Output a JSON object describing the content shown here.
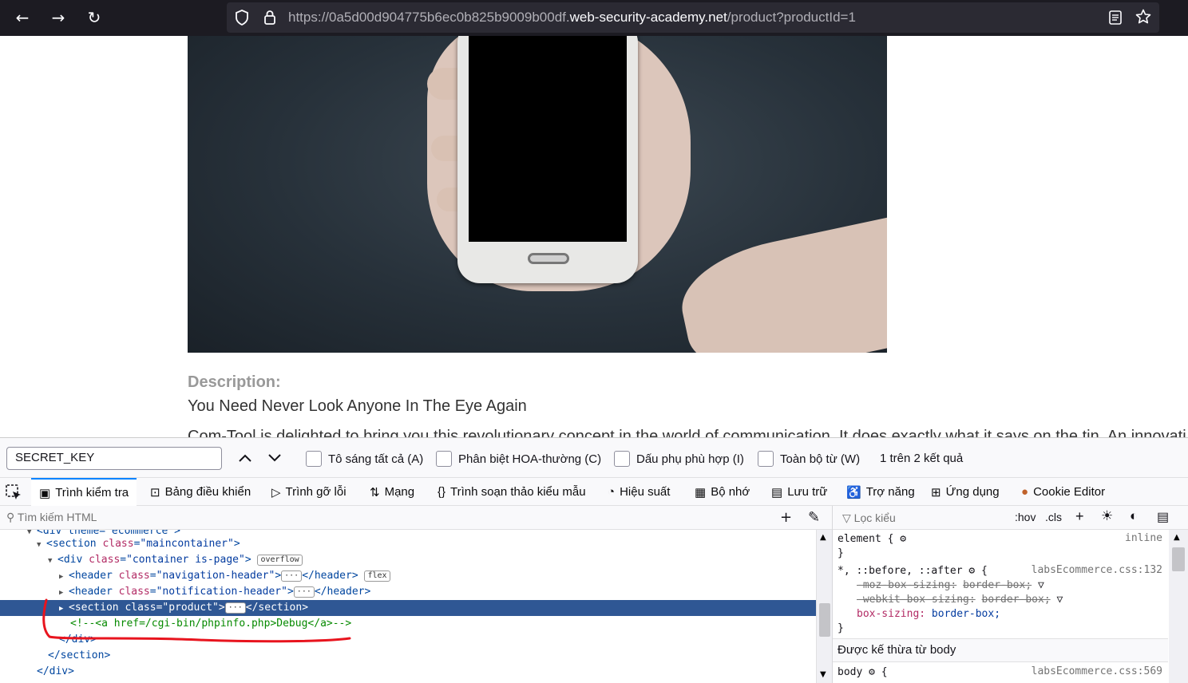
{
  "browser": {
    "back_icon": "←",
    "forward_icon": "→",
    "reload_icon": "↻",
    "url_prefix": "https://0a5d00d904775b6ec0b825b9009b00df.",
    "url_domain": "web-security-academy.net",
    "url_path": "/product?productId=1"
  },
  "page": {
    "description_label": "Description:",
    "product_title": "You Need Never Look Anyone In The Eye Again",
    "description_text": "Com-Tool is delighted to bring you this revolutionary concept in the world of communication. It does exactly what it says on the tin. An innovati"
  },
  "findbar": {
    "query": "SECRET_KEY",
    "options": [
      "Tô sáng tất cả (A)",
      "Phân biệt HOA-thường (C)",
      "Dấu phụ phù hợp (I)",
      "Toàn bộ từ (W)"
    ],
    "result_count": "1 trên 2 kết quả"
  },
  "devtools": {
    "tabs": [
      "Trình kiểm tra",
      "Bảng điều khiển",
      "Trình gỡ lỗi",
      "Mạng",
      "Trình soạn thảo kiểu mẫu",
      "Hiệu suất",
      "Bộ nhớ",
      "Lưu trữ",
      "Trợ năng",
      "Ứng dụng",
      "Cookie Editor"
    ],
    "html_search_placeholder": "Tìm kiếm HTML",
    "markup": {
      "line0": "<div theme=\"ecommerce\">",
      "line1_tag_open": "<section ",
      "line1_attr": "class",
      "line1_val": "\"maincontainer\"",
      "line2_tag_open": "<div ",
      "line2_attr": "class",
      "line2_val": "\"container is-page\"",
      "line2_badge": "overflow",
      "line3_attr": "class",
      "line3_val": "\"navigation-header\"",
      "line3_badge": "flex",
      "line4_attr": "class",
      "line4_val": "\"notification-header\"",
      "line5_attr": "class",
      "line5_val": "\"product\"",
      "comment": "<!--<a href=/cgi-bin/phpinfo.php>Debug</a>-->",
      "close_div": "</div>",
      "close_section": "</section>",
      "close_div2": "</div>"
    },
    "rules": {
      "filter_placeholder": "Lọc kiểu",
      "hov": ":hov",
      "cls": ".cls",
      "element_selector": "element {",
      "inline": "inline",
      "close": "}",
      "universal_selector": "*, ::before, ::after",
      "source": "labsEcommerce.css:132",
      "moz_prop": "-moz-box-sizing:",
      "moz_val": "border-box;",
      "webkit_prop": "-webkit-box-sizing:",
      "webkit_val": "border-box;",
      "box_prop": "box-sizing:",
      "box_val": "border-box;",
      "inherited_label": "Được kế thừa từ body",
      "body_selector": "body",
      "body_source": "labsEcommerce.css:569"
    }
  }
}
